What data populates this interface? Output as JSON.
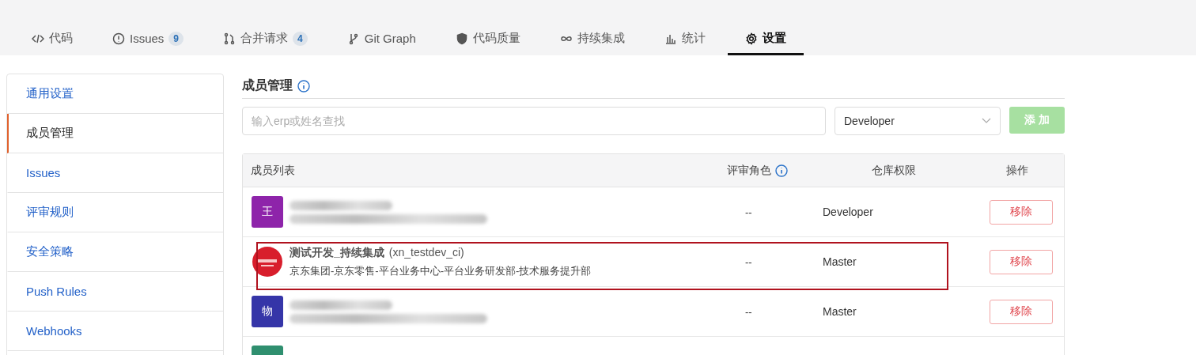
{
  "tabs": [
    {
      "label": "代码",
      "selected": false
    },
    {
      "label": "Issues",
      "count": "9",
      "selected": false
    },
    {
      "label": "合并请求",
      "count": "4",
      "selected": false
    },
    {
      "label": "Git Graph",
      "selected": false
    },
    {
      "label": "代码质量",
      "selected": false
    },
    {
      "label": "持续集成",
      "selected": false
    },
    {
      "label": "统计",
      "selected": false
    },
    {
      "label": "设置",
      "selected": true
    }
  ],
  "sidebar": {
    "items": [
      {
        "label": "通用设置",
        "selected": false
      },
      {
        "label": "成员管理",
        "selected": true
      },
      {
        "label": "Issues",
        "selected": false
      },
      {
        "label": "评审规则",
        "selected": false
      },
      {
        "label": "安全策略",
        "selected": false
      },
      {
        "label": "Push Rules",
        "selected": false
      },
      {
        "label": "Webhooks",
        "selected": false
      }
    ]
  },
  "section_title": "成员管理",
  "search": {
    "placeholder": "输入erp或姓名查找"
  },
  "role_select": {
    "value": "Developer"
  },
  "add_button": {
    "label": "添 加",
    "disabled": true
  },
  "table": {
    "columns": [
      "成员列表",
      "评审角色",
      "仓库权限",
      "操作"
    ],
    "rows": [
      {
        "kind": "redacted",
        "avatar": "王",
        "color": "#8e24aa",
        "review_role": "--",
        "permission": "Developer",
        "action": "移除",
        "highlighted": false
      },
      {
        "kind": "member",
        "color": "#d81e2c",
        "name": "测试开发_持续集成",
        "username": "(xn_testdev_ci)",
        "department": "京东集团-京东零售-平台业务中心-平台业务研发部-技术服务提升部",
        "review_role": "--",
        "permission": "Master",
        "action": "移除",
        "highlighted": true
      },
      {
        "kind": "redacted",
        "avatar": "物",
        "color": "#3535a8",
        "review_role": "--",
        "permission": "Master",
        "action": "移除",
        "highlighted": false
      },
      {
        "kind": "partial",
        "color": "#2f8f6f",
        "highlighted": false
      }
    ]
  }
}
